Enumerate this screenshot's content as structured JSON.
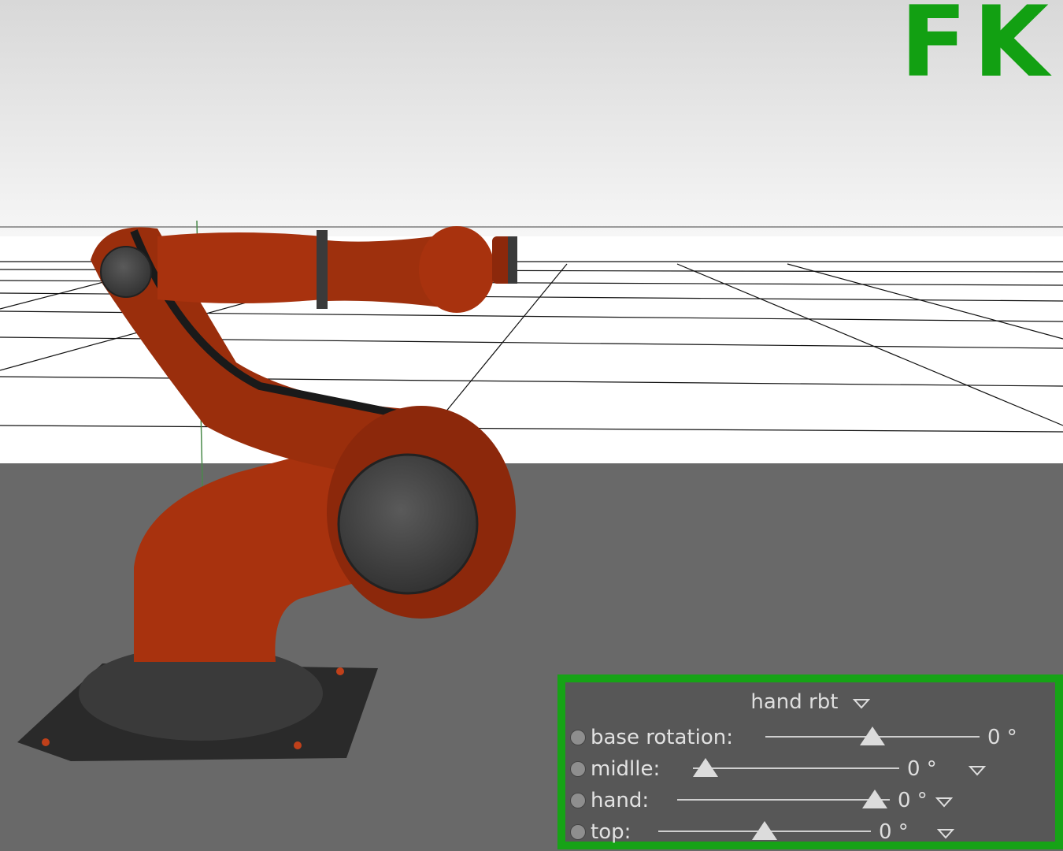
{
  "viewport": {
    "mode_label": "FK",
    "mode_color": "#12a012",
    "robot_color": "#a8320e"
  },
  "panel": {
    "title": "hand rbt",
    "title_caret_icon": "chevron-down-icon",
    "rows": [
      {
        "label": "base rotation:",
        "value": "0 °",
        "slider_position": 0.5
      },
      {
        "label": "midlle:",
        "value": "0 °",
        "slider_position": 0.06
      },
      {
        "label": "hand:",
        "value": "0 °",
        "slider_position": 0.93
      },
      {
        "label": "top:",
        "value": "0 °",
        "slider_position": 0.5
      }
    ]
  }
}
